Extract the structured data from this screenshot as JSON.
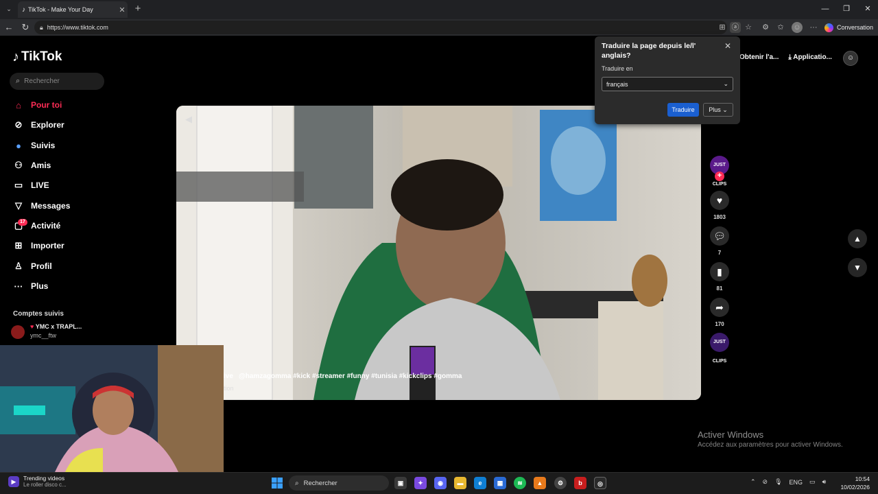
{
  "browser": {
    "tab_title": "TikTok - Make Your Day",
    "url": "https://www.tiktok.com",
    "conversation_label": "Conversation",
    "new_tab": "+",
    "close_tab": "✕"
  },
  "tiktok": {
    "brand": "TikTok",
    "search_placeholder": "Rechercher",
    "nav": [
      {
        "label": "Pour toi",
        "icon": "⌂"
      },
      {
        "label": "Explorer",
        "icon": "⊘"
      },
      {
        "label": "Suivis",
        "icon": "●"
      },
      {
        "label": "Amis",
        "icon": "⚇"
      },
      {
        "label": "LIVE",
        "icon": "▭"
      },
      {
        "label": "Messages",
        "icon": "▽"
      },
      {
        "label": "Activité",
        "icon": "▢"
      },
      {
        "label": "Importer",
        "icon": "⊞"
      },
      {
        "label": "Profil",
        "icon": "♙"
      },
      {
        "label": "Plus",
        "icon": "···"
      }
    ],
    "activity_badge": "17",
    "followed_heading": "Comptes suivis",
    "followed_account": {
      "name": "YMC x TRAPL...",
      "user": "ymc__ftw"
    },
    "header_links": [
      "Obtenir l'a...",
      "Applicatio..."
    ],
    "video": {
      "live_prefix": "ive",
      "caption": "@hamzagomma #kick #streamer #funny #tunisia #kickclips #gomma",
      "sub": "tion"
    },
    "actions": {
      "likes": "1803",
      "comments": "7",
      "saves": "81",
      "shares": "170",
      "creator_label": "JUST CLIPS"
    }
  },
  "translate_popup": {
    "title": "Traduire la page depuis le/l' anglais?",
    "label": "Traduire en",
    "language": "français",
    "translate_button": "Traduire",
    "more_button": "Plus"
  },
  "watermark": {
    "line1": "Activer Windows",
    "line2": "Accédez aux paramètres pour activer Windows."
  },
  "taskbar": {
    "news_title": "Trending videos",
    "news_sub": "Le roller disco c...",
    "search": "Rechercher",
    "lang": "ENG",
    "time": "10:54",
    "date": "10/02/2026"
  },
  "colors": {
    "accent": "#fe2c55",
    "translate_blue": "#1a5fd0"
  }
}
